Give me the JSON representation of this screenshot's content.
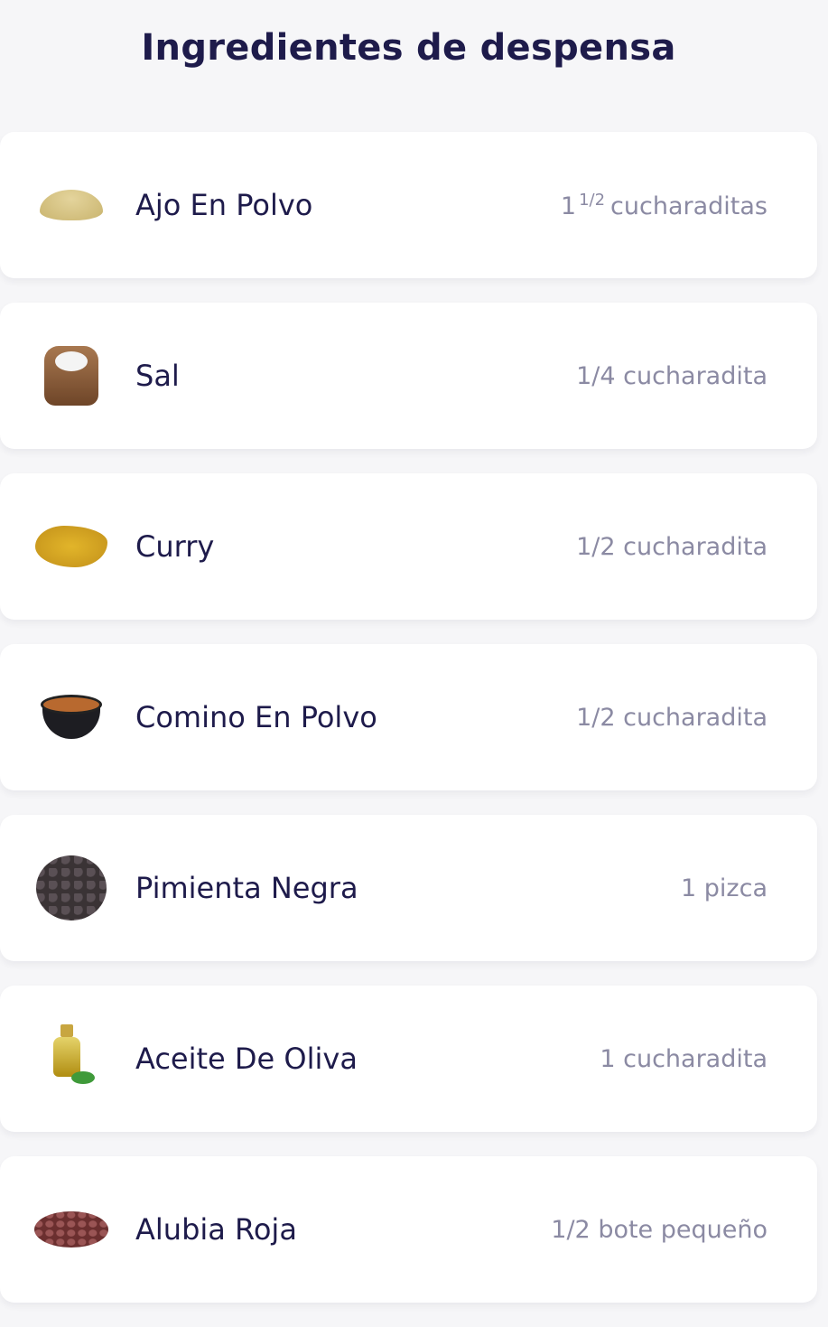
{
  "title": "Ingredientes de despensa",
  "ingredients": [
    {
      "name": "Ajo En Polvo",
      "qty_whole": "1",
      "qty_frac": "1/2",
      "qty_unit": "cucharaditas",
      "icon": "garlic-powder-icon",
      "color": "#d4c184"
    },
    {
      "name": "Sal",
      "qty": "1/4 cucharadita",
      "icon": "salt-sack-icon",
      "color": "#8a5a3a"
    },
    {
      "name": "Curry",
      "qty": "1/2 cucharadita",
      "icon": "curry-powder-icon",
      "color": "#d4a017"
    },
    {
      "name": "Comino En Polvo",
      "qty": "1/2 cucharadita",
      "icon": "cumin-bowl-icon",
      "color": "#b5652e"
    },
    {
      "name": "Pimienta Negra",
      "qty": "1 pizca",
      "icon": "black-pepper-icon",
      "color": "#3a3335"
    },
    {
      "name": "Aceite De Oliva",
      "qty": "1 cucharadita",
      "icon": "olive-oil-icon",
      "color": "#c9a21a"
    },
    {
      "name": "Alubia Roja",
      "qty": "1/2 bote pequeño",
      "icon": "red-beans-icon",
      "color": "#6b2f2f"
    }
  ]
}
